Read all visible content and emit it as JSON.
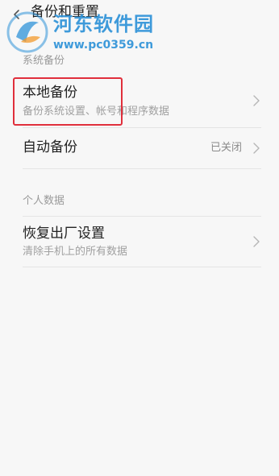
{
  "header": {
    "back_icon": "chevron-left-icon",
    "title": "备份和重置"
  },
  "watermark": {
    "name": "河东软件园",
    "url": "www.pc0359.cn",
    "color": "#2f93d8"
  },
  "sections": [
    {
      "header": "系统备份",
      "items": [
        {
          "title": "本地备份",
          "subtitle": "备份系统设置、帐号和程序数据",
          "value": "",
          "chevron": "chevron-right-icon",
          "highlighted": true
        },
        {
          "title": "自动备份",
          "subtitle": "",
          "value": "已关闭",
          "chevron": "chevron-right-icon",
          "highlighted": false
        }
      ]
    },
    {
      "header": "个人数据",
      "items": [
        {
          "title": "恢复出厂设置",
          "subtitle": "清除手机上的所有数据",
          "value": "",
          "chevron": "chevron-right-icon",
          "highlighted": false
        }
      ]
    }
  ],
  "colors": {
    "background": "#f7f7f7",
    "highlight": "#e02f3c",
    "secondary_text": "#9a9a9a"
  }
}
